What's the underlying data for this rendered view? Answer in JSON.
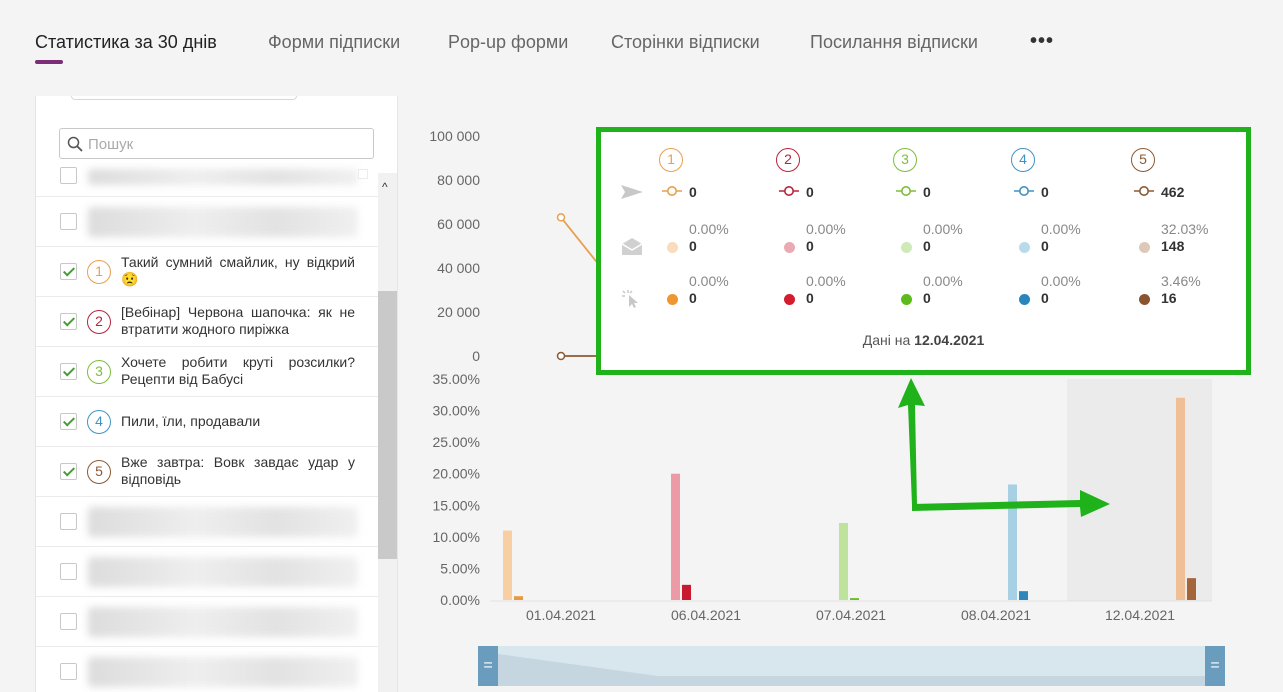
{
  "tabs": [
    {
      "label": "Статистика за 30 днів",
      "active": true
    },
    {
      "label": "Форми підписки"
    },
    {
      "label": "Pop-up форми"
    },
    {
      "label": "Сторінки відписки"
    },
    {
      "label": "Посилання відписки"
    }
  ],
  "more_label": "•••",
  "sidebar": {
    "search_placeholder": "Пошук",
    "items": [
      {
        "num": "1",
        "text": "Такий сумний смайлик, ну відкрий 😟",
        "checked": true,
        "color": "#e6a04e"
      },
      {
        "num": "2",
        "text": "[Вебінар] Червона шапочка: як не втратити жодного пиріжка",
        "checked": true,
        "color": "#b5243a"
      },
      {
        "num": "3",
        "text": "Хочете робити круті розсилки? Рецепти від Бабусі",
        "checked": true,
        "color": "#7cbd3a"
      },
      {
        "num": "4",
        "text": "Пили, їли, продавали",
        "checked": true,
        "color": "#3f93c2"
      },
      {
        "num": "5",
        "text": "Вже завтра: Вовк завдає удар у відповідь",
        "checked": true,
        "color": "#8a5a34"
      }
    ]
  },
  "chart_data": [
    {
      "type": "line",
      "ylim": [
        0,
        100000
      ],
      "yticks": [
        "100 000",
        "80 000",
        "60 000",
        "40 000",
        "20 000",
        "0"
      ],
      "series": [
        {
          "name": "1",
          "color": "#e6a04e",
          "points": [
            {
              "x": "01.04.2021",
              "y": 63000
            }
          ]
        },
        {
          "name": "5",
          "color": "#8a5a34",
          "points": [
            {
              "x": "01.04.2021",
              "y": 0
            }
          ]
        }
      ]
    },
    {
      "type": "bar",
      "ylim": [
        0,
        35
      ],
      "yticks": [
        "35.00%",
        "30.00%",
        "25.00%",
        "20.00%",
        "15.00%",
        "10.00%",
        "5.00%",
        "0.00%"
      ],
      "categories": [
        "01.04.2021",
        "06.04.2021",
        "07.04.2021",
        "08.04.2021",
        "12.04.2021"
      ],
      "series": [
        {
          "name": "1",
          "open_color": "#f8cfa3",
          "click_color": "#e89a3c",
          "open": 11.0,
          "click": 0.6
        },
        {
          "name": "2",
          "open_color": "#ec9aa6",
          "click_color": "#c8192e",
          "open": 20.0,
          "click": 2.4
        },
        {
          "name": "3",
          "open_color": "#bde39d",
          "click_color": "#6bbf2a",
          "open": 12.2,
          "click": 0.3
        },
        {
          "name": "4",
          "open_color": "#a8d0e4",
          "click_color": "#2f86bb",
          "open": 18.3,
          "click": 1.4
        },
        {
          "name": "5",
          "open_color": "#f0bf96",
          "click_color": "#a5653a",
          "open": 32.03,
          "click": 3.46
        }
      ]
    }
  ],
  "tooltip": {
    "columns": [
      {
        "num": "1",
        "color": "#e6a04e",
        "light": "#f9dcbb",
        "dark": "#ee9632",
        "sent": "0",
        "open_pct": "0.00%",
        "open": "0",
        "click_pct": "0.00%",
        "click": "0"
      },
      {
        "num": "2",
        "color": "#b5243a",
        "light": "#e9aab4",
        "dark": "#d51b2c",
        "sent": "0",
        "open_pct": "0.00%",
        "open": "0",
        "click_pct": "0.00%",
        "click": "0"
      },
      {
        "num": "3",
        "color": "#7cbd3a",
        "light": "#cfeab8",
        "dark": "#5cbb1c",
        "sent": "0",
        "open_pct": "0.00%",
        "open": "0",
        "click_pct": "0.00%",
        "click": "0"
      },
      {
        "num": "4",
        "color": "#3f93c2",
        "light": "#b9dbe9",
        "dark": "#2a86ba",
        "sent": "0",
        "open_pct": "0.00%",
        "open": "0",
        "click_pct": "0.00%",
        "click": "0"
      },
      {
        "num": "5",
        "color": "#8a5a34",
        "light": "#dec8ba",
        "dark": "#8a5430",
        "sent": "462",
        "open_pct": "32.03%",
        "open": "148",
        "click_pct": "3.46%",
        "click": "16"
      }
    ],
    "footer_prefix": "Дані на ",
    "footer_date": "12.04.2021"
  },
  "navigator": {
    "handle_label": "="
  },
  "colors": {
    "accent": "#7b2d77",
    "highlight": "#1fb21b"
  }
}
